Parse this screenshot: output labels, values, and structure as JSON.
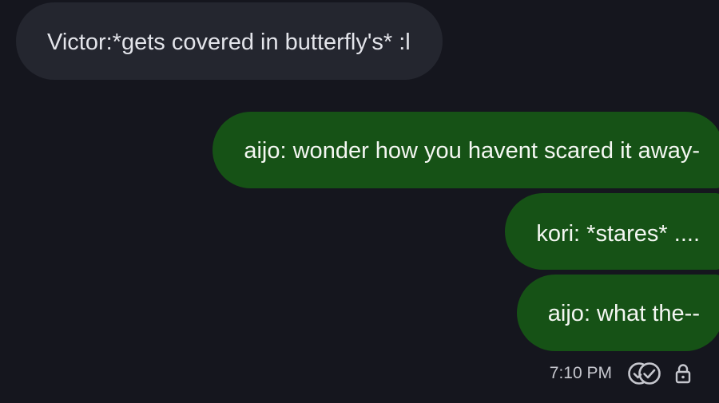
{
  "messages": [
    {
      "direction": "incoming",
      "text": "Victor:*gets covered in butterfly's* :l"
    },
    {
      "direction": "outgoing",
      "text": "aijo: wonder how you havent scared it away-"
    },
    {
      "direction": "outgoing",
      "text": "kori: *stares* ...."
    },
    {
      "direction": "outgoing",
      "text": "aijo: what the--"
    }
  ],
  "status": {
    "time": "7:10 PM",
    "read_icon": "double-check-icon",
    "encryption_icon": "lock-icon"
  },
  "colors": {
    "background": "#15161e",
    "incoming_bubble": "#24262f",
    "outgoing_bubble": "#165216"
  }
}
